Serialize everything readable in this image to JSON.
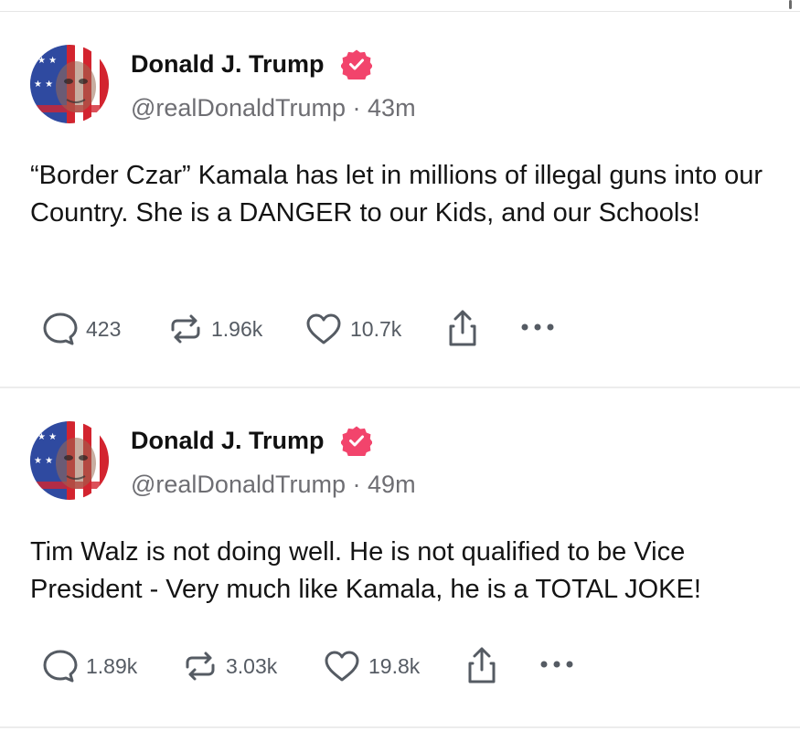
{
  "posts": [
    {
      "author": "Donald J. Trump",
      "handle": "@realDonaldTrump",
      "separator": "·",
      "time": "43m",
      "text": "“Border Czar” Kamala has let in millions of illegal guns into our Country. She is a DANGER to our Kids, and our Schools!",
      "replies": "423",
      "retruths": "1.96k",
      "likes": "10.7k"
    },
    {
      "author": "Donald J. Trump",
      "handle": "@realDonaldTrump",
      "separator": "·",
      "time": "49m",
      "text": "Tim Walz is not doing well. He is not qualified to be Vice President - Very much like Kamala, he is a TOTAL JOKE!",
      "replies": "1.89k",
      "retruths": "3.03k",
      "likes": "19.8k"
    }
  ],
  "icons": {
    "reply": "speech-bubble-icon",
    "retruth": "repost-arrows-icon",
    "like": "heart-icon",
    "share": "share-upload-icon",
    "more": "more-dots-icon",
    "verified": "verified-badge-icon"
  },
  "colors": {
    "verified_badge": "#f2446c",
    "muted_text": "#6e6e73",
    "action_text": "#555b63"
  }
}
